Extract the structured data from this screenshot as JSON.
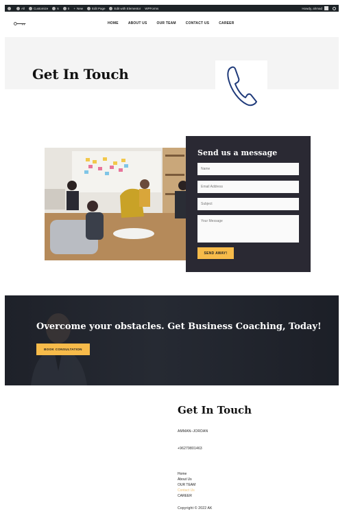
{
  "admin_bar": {
    "items": [
      "All",
      "Customize",
      "6",
      "0",
      "New",
      "Edit Page",
      "Edit with Elementor",
      "WPForms"
    ],
    "greeting": "Howdy, ahmad"
  },
  "nav": {
    "items": [
      "HOME",
      "ABOUT US",
      "OUR TEAM",
      "CONTACT US",
      "CAREER"
    ]
  },
  "hero": {
    "title": "Get In Touch"
  },
  "form": {
    "title": "Send us a message",
    "name_placeholder": "Name",
    "email_placeholder": "Email Address",
    "subject_placeholder": "Subject",
    "message_placeholder": "Your Message",
    "submit_label": "SEND AWAY!"
  },
  "cta": {
    "title": "Overcome your obstacles. Get Business Coaching, Today!",
    "button_label": "BOOK CONSULTATION"
  },
  "footer": {
    "title": "Get In Touch",
    "location": "AMMAN–JORDAN",
    "phone": "+96279801463",
    "links": [
      "Home",
      "About Us",
      "OUR TEAM",
      "Contact Us",
      "CAREER"
    ],
    "copyright": "Copyright © 2022 AK"
  },
  "colors": {
    "accent": "#f7bb4a",
    "dark_panel": "#2a2933",
    "phone_icon": "#1f3a7a"
  }
}
